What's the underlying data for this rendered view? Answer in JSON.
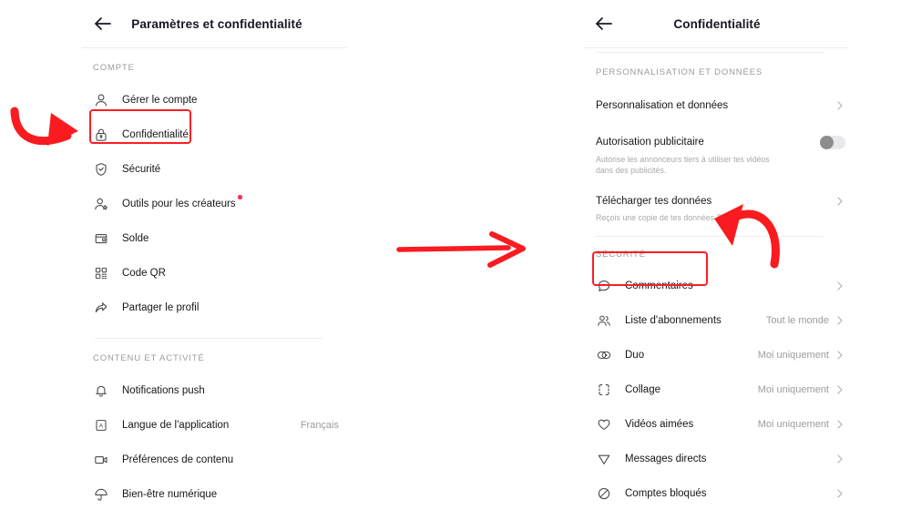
{
  "meta": {
    "accent_red": "#fb1e25",
    "badge_red": "#fe2c55",
    "text_primary": "#16161a",
    "text_muted": "#9b9ca0",
    "divider": "#ececee"
  },
  "left_panel": {
    "back_icon": "back-arrow-icon",
    "title": "Paramètres et confidentialité",
    "sections": [
      {
        "label": "COMPTE",
        "items": [
          {
            "icon": "person-icon",
            "label": "Gérer le compte",
            "value": "",
            "chevron": false,
            "badge": false
          },
          {
            "icon": "lock-icon",
            "label": "Confidentialité",
            "value": "",
            "chevron": false,
            "badge": false
          },
          {
            "icon": "shield-check-icon",
            "label": "Sécurité",
            "value": "",
            "chevron": false,
            "badge": false
          },
          {
            "icon": "person-star-icon",
            "label": "Outils pour les créateurs",
            "value": "",
            "chevron": false,
            "badge": true
          },
          {
            "icon": "wallet-icon",
            "label": "Solde",
            "value": "",
            "chevron": false,
            "badge": false
          },
          {
            "icon": "qr-code-icon",
            "label": "Code QR",
            "value": "",
            "chevron": false,
            "badge": false
          },
          {
            "icon": "share-icon",
            "label": "Partager le profil",
            "value": "",
            "chevron": false,
            "badge": false
          }
        ]
      },
      {
        "label": "CONTENU ET ACTIVITÉ",
        "items": [
          {
            "icon": "bell-icon",
            "label": "Notifications push",
            "value": "",
            "chevron": false,
            "badge": false
          },
          {
            "icon": "language-icon",
            "label": "Langue de l'application",
            "value": "Français",
            "chevron": false,
            "badge": false
          },
          {
            "icon": "video-icon",
            "label": "Préférences de contenu",
            "value": "",
            "chevron": false,
            "badge": false
          },
          {
            "icon": "umbrella-icon",
            "label": "Bien-être numérique",
            "value": "",
            "chevron": false,
            "badge": false
          }
        ]
      }
    ]
  },
  "right_panel": {
    "back_icon": "back-arrow-icon",
    "title": "Confidentialité",
    "section_personalisation": {
      "label": "PERSONNALISATION ET DONNÉES",
      "rows": [
        {
          "type": "link",
          "title": "Personnalisation et données",
          "subtitle": "",
          "chevron": true
        },
        {
          "type": "toggle",
          "title": "Autorisation publicitaire",
          "subtitle": "Autorise les annonceurs tiers à utiliser tes vidéos dans des publicités.",
          "toggle_on": false
        },
        {
          "type": "link",
          "title": "Télécharger tes données",
          "subtitle": "Reçois une copie de tes données TikTok",
          "chevron": true
        }
      ]
    },
    "section_securite": {
      "label": "SÉCURITÉ",
      "items": [
        {
          "icon": "comment-icon",
          "label": "Commentaires",
          "value": "",
          "chevron": true
        },
        {
          "icon": "people-icon",
          "label": "Liste d'abonnements",
          "value": "Tout le monde",
          "chevron": true
        },
        {
          "icon": "duet-icon",
          "label": "Duo",
          "value": "Moi uniquement",
          "chevron": true
        },
        {
          "icon": "stitch-icon",
          "label": "Collage",
          "value": "Moi uniquement",
          "chevron": true
        },
        {
          "icon": "heart-icon",
          "label": "Vidéos aimées",
          "value": "Moi uniquement",
          "chevron": true
        },
        {
          "icon": "paper-plane-icon",
          "label": "Messages directs",
          "value": "",
          "chevron": true
        },
        {
          "icon": "block-icon",
          "label": "Comptes bloqués",
          "value": "",
          "chevron": true
        }
      ]
    }
  },
  "annotations": {
    "arrow_left": "curved-arrow-pointing-right",
    "arrow_middle": "straight-arrow-pointing-right",
    "arrow_right": "curved-arrow-pointing-down-left",
    "highlight_left": "Confidentialité",
    "highlight_right": "Commentaires"
  }
}
